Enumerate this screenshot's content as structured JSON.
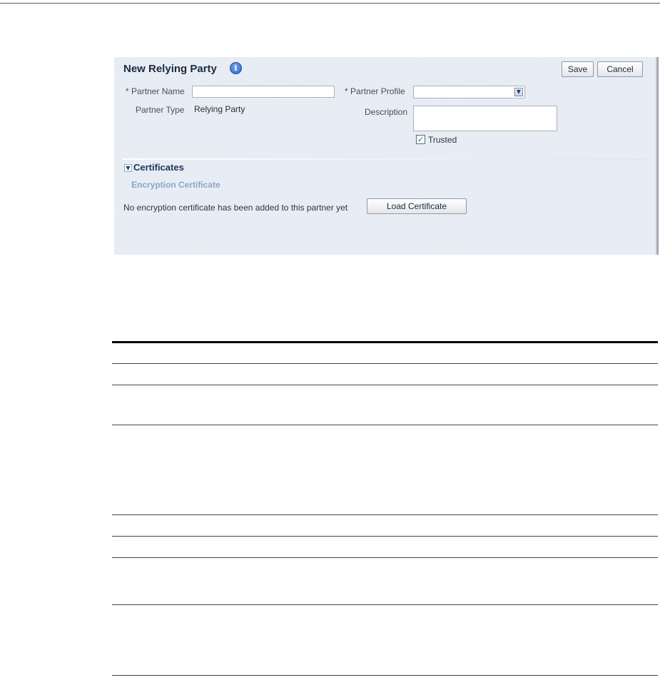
{
  "panel": {
    "title": "New Relying Party",
    "buttons": {
      "save": "Save",
      "cancel": "Cancel"
    },
    "fields": {
      "partner_name": {
        "required_mark": "*",
        "label": "Partner Name",
        "value": ""
      },
      "partner_type": {
        "label": "Partner Type",
        "value": "Relying Party"
      },
      "partner_profile": {
        "required_mark": "*",
        "label": "Partner Profile",
        "value": ""
      },
      "description": {
        "label": "Description",
        "value": ""
      },
      "trusted": {
        "label": "Trusted",
        "checked": true
      }
    },
    "certificates": {
      "section_title": "Certificates",
      "encryption_title": "Encryption Certificate",
      "no_cert_message": "No encryption certificate has been added to this partner yet",
      "load_button": "Load Certificate"
    }
  },
  "icons": {
    "info": "info-icon",
    "dropdown": "chevron-down-icon",
    "collapse": "chevron-down-icon",
    "checkmark": "check-icon"
  }
}
